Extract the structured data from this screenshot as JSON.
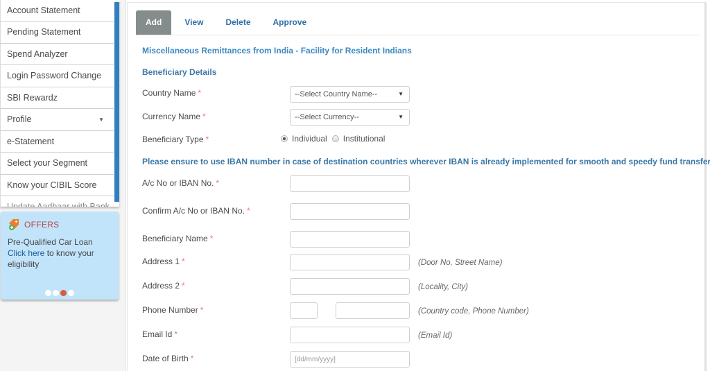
{
  "sidebar": {
    "items": [
      {
        "label": "Account Statement"
      },
      {
        "label": "Pending Statement"
      },
      {
        "label": "Spend Analyzer"
      },
      {
        "label": "Login Password Change"
      },
      {
        "label": "SBI Rewardz"
      },
      {
        "label": "Profile",
        "has_dropdown": true
      },
      {
        "label": "e-Statement"
      },
      {
        "label": "Select your Segment"
      },
      {
        "label": "Know your CIBIL Score"
      },
      {
        "label": "Update Aadhaar with Bank"
      }
    ],
    "offers": {
      "title": "OFFERS",
      "line1": "Pre-Qualified Car Loan",
      "link": "Click here",
      "line2": " to know your eligibility",
      "slide_count": 4,
      "active_slide": 3
    }
  },
  "tabs": [
    {
      "label": "Add",
      "active": true
    },
    {
      "label": "View",
      "active": false
    },
    {
      "label": "Delete",
      "active": false
    },
    {
      "label": "Approve",
      "active": false
    }
  ],
  "form": {
    "title": "Miscellaneous Remittances from India - Facility for Resident Indians",
    "section": "Beneficiary Details",
    "required_marker": "*",
    "country": {
      "label": "Country Name",
      "value": "--Select Country Name--"
    },
    "currency": {
      "label": "Currency Name",
      "value": "--Select Currency--"
    },
    "beneficiary_type": {
      "label": "Beneficiary Type",
      "options": [
        "Individual",
        "Institutional"
      ],
      "selected": "Individual"
    },
    "iban_notice": "Please ensure to use IBAN number in case of destination countries wherever IBAN is already implemented for smooth and speedy fund transfer.",
    "account_no": {
      "label": "A/c No or IBAN No.",
      "value": ""
    },
    "confirm_account_no": {
      "label": "Confirm A/c No or IBAN No.",
      "value": ""
    },
    "beneficiary_name": {
      "label": "Beneficiary Name",
      "value": ""
    },
    "address1": {
      "label": "Address 1",
      "value": "",
      "hint": "(Door No, Street Name)"
    },
    "address2": {
      "label": "Address 2",
      "value": "",
      "hint": "(Locality, City)"
    },
    "phone": {
      "label": "Phone Number",
      "country_code": "",
      "number": "",
      "hint": "(Country code, Phone Number)"
    },
    "email": {
      "label": "Email Id",
      "value": "",
      "hint": "(Email Id)"
    },
    "dob": {
      "label": "Date of Birth",
      "placeholder": "[dd/mm/yyyy]"
    }
  },
  "colors": {
    "accent_blue": "#2f7fc1",
    "link_blue": "#3d8ac2",
    "active_tab": "#858c8c",
    "required": "#e27d6b",
    "offers_bg": "#c2e4fb",
    "offers_title": "#b5484b",
    "active_dot": "#d85c3a"
  }
}
